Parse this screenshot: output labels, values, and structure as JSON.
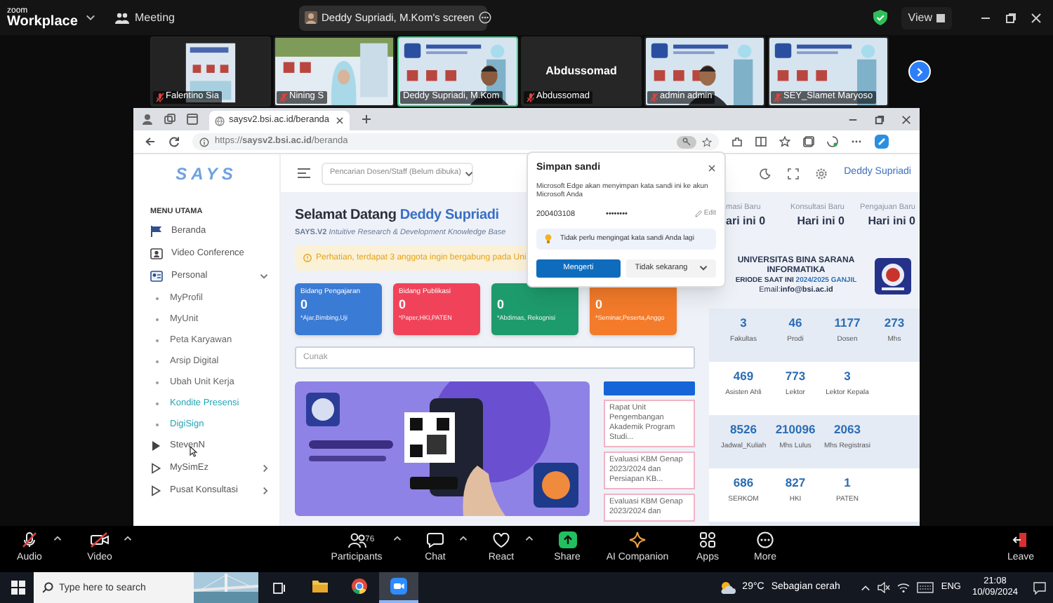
{
  "zoom_bar": {
    "brand_top": "zoom",
    "brand_bottom": "Workplace",
    "meeting_menu": "Meeting",
    "screen_pill": "Deddy Supriadi, M.Kom's screen",
    "view_button": "View"
  },
  "video_tiles": [
    {
      "kind": "picture",
      "name": "Falentino Sia",
      "muted": true,
      "speaking": false
    },
    {
      "kind": "picture",
      "name": "Nining S",
      "muted": true,
      "speaking": false
    },
    {
      "kind": "picture",
      "name": "Deddy Supriadi, M.Kom",
      "muted": false,
      "speaking": true
    },
    {
      "kind": "name_only",
      "display_name": "Abdussomad",
      "name": "Abdussomad",
      "muted": true,
      "speaking": false
    },
    {
      "kind": "picture",
      "name": "admin admin",
      "muted": true,
      "speaking": false
    },
    {
      "kind": "picture",
      "name": "SEY_Slamet Maryoso",
      "muted": true,
      "speaking": false
    }
  ],
  "browser": {
    "tab_title": "saysv2.bsi.ac.id/beranda",
    "url": "https://**saysv2.bsi.ac.id**/beranda"
  },
  "sidebar": {
    "logo": "SAYS",
    "heading": "MENU UTAMA",
    "items": [
      {
        "label": "Beranda"
      },
      {
        "label": "Video Conference"
      },
      {
        "label": "Personal",
        "expanded": true,
        "children": [
          {
            "label": "MyProfil",
            "highlighted": false
          },
          {
            "label": "MyUnit",
            "highlighted": false
          },
          {
            "label": "Peta Karyawan",
            "highlighted": false
          },
          {
            "label": "Arsip Digital",
            "highlighted": false
          },
          {
            "label": "Ubah Unit Kerja",
            "highlighted": false
          },
          {
            "label": "Kondite Presensi",
            "highlighted": true
          },
          {
            "label": "DigiSign",
            "highlighted": true
          }
        ]
      },
      {
        "label": "StevenN"
      },
      {
        "label": "MySimEz",
        "expanded": false
      },
      {
        "label": "Pusat Konsultasi",
        "expanded": false
      }
    ]
  },
  "header": {
    "search_dropdown": "Pencarian Dosen/Staff (Belum dibuka)",
    "user_name": "Deddy Supriadi"
  },
  "welcome": {
    "greeting": "Selamat Datang",
    "name": "Deddy Supriadi",
    "subtitle": "**SAYS.V2** *Intuitive Research & Development Knowledge Base*",
    "alert": "Perhatian, terdapat 3 anggota ingin bergabung pada Uni"
  },
  "stat_cards": [
    {
      "title": "Bidang Pengajaran",
      "value": "0",
      "note": "*Ajar,Bimbing,Uji",
      "color": "#3a7bd5"
    },
    {
      "title": "Bidang Publikasi",
      "value": "0",
      "note": "*Paper,HKI,PATEN",
      "color": "#f0435a"
    },
    {
      "value": "0",
      "note": "*Abdimas, Rekognisi",
      "color": "#1e9b6c"
    },
    {
      "value": "0",
      "note": "*Seminar,Peserta,Anggo",
      "color": "#f47b2a"
    }
  ],
  "search": {
    "placeholder": "Cunak"
  },
  "news": {
    "items": [
      "Rapat Unit Pengembangan Akademik Program Studi...",
      "Evaluasi KBM Genap 2023/2024 dan Persiapan KB...",
      "Evaluasi KBM Genap 2023/2024 dan"
    ]
  },
  "right_panel": {
    "new_counts": [
      {
        "label": "masi Baru",
        "value": "ari ini 0"
      },
      {
        "label": "Konsultasi Baru",
        "value": "Hari ini 0"
      },
      {
        "label": "Pengajuan Baru",
        "value": "Hari ini 0"
      }
    ],
    "university": "UNIVERSITAS BINA SARANA INFORMATIKA",
    "period_label": "ERIODE SAAT INI",
    "period_value": "2024/2025 GANJIL",
    "email": "Email:**info@bsi.ac.id**",
    "stat_rows": [
      [
        {
          "value": "3",
          "label": "Fakultas"
        },
        {
          "value": "46",
          "label": "Prodi"
        },
        {
          "value": "1177",
          "label": "Dosen"
        },
        {
          "value": "273",
          "label": "Mhs"
        }
      ],
      [
        {
          "value": "469",
          "label": "Asisten Ahli"
        },
        {
          "value": "773",
          "label": "Lektor"
        },
        {
          "value": "3",
          "label": "Lektor Kepala"
        }
      ],
      [
        {
          "value": "8526",
          "label": "Jadwal_Kuliah"
        },
        {
          "value": "210096",
          "label": "Mhs Lulus"
        },
        {
          "value": "2063",
          "label": "Mhs Registrasi"
        }
      ],
      [
        {
          "value": "686",
          "label": "SERKOM"
        },
        {
          "value": "827",
          "label": "HKI"
        },
        {
          "value": "1",
          "label": "PATEN"
        }
      ]
    ]
  },
  "password_popup": {
    "title": "Simpan sandi",
    "message": "Microsoft Edge akan menyimpan kata sandi ini ke akun Microsoft Anda",
    "username": "200403108",
    "password": "••••••••",
    "edit": "Edit",
    "tip": "Tidak perlu mengingat kata sandi Anda lagi",
    "primary_button": "Mengerti",
    "secondary_button": "Tidak sekarang"
  },
  "toolbar": {
    "items": [
      {
        "label": "Audio",
        "on": false,
        "caret": true
      },
      {
        "label": "Video",
        "on": false,
        "caret": true
      },
      {
        "label": "Participants",
        "badge": "76",
        "caret": true
      },
      {
        "label": "Chat",
        "caret": true
      },
      {
        "label": "React",
        "caret": true
      },
      {
        "label": "Share",
        "caret": false
      },
      {
        "label": "AI Companion",
        "caret": false
      },
      {
        "label": "Apps",
        "caret": false
      },
      {
        "label": "More",
        "caret": false
      }
    ],
    "leave": "Leave"
  },
  "taskbar": {
    "search_placeholder": "Type here to search",
    "apps": [
      {
        "selected": false
      },
      {
        "selected": false
      },
      {
        "selected": true
      }
    ],
    "weather": "29°C",
    "weather_text": "Sebagian cerah",
    "language": "ENG",
    "time": "21:08",
    "date": "10/09/2024"
  }
}
